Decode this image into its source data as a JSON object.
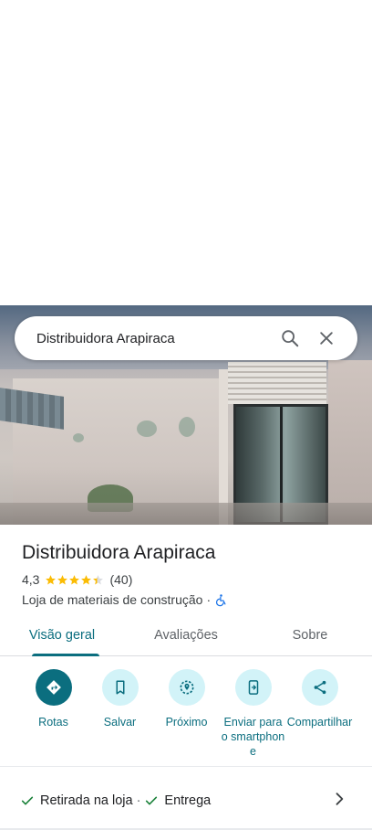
{
  "search": {
    "query": "Distribuidora Arapiraca",
    "search_icon": "search-icon",
    "close_icon": "close-icon"
  },
  "place": {
    "name": "Distribuidora Arapiraca",
    "rating": "4,3",
    "rating_value": 4.3,
    "reviews_count": "(40)",
    "category": "Loja de materiais de construção",
    "separator": "·",
    "accessibility_icon": "wheelchair-icon"
  },
  "tabs": [
    {
      "label": "Visão geral",
      "active": true
    },
    {
      "label": "Avaliações",
      "active": false
    },
    {
      "label": "Sobre",
      "active": false
    }
  ],
  "actions": [
    {
      "label": "Rotas",
      "icon": "directions-icon"
    },
    {
      "label": "Salvar",
      "icon": "bookmark-icon"
    },
    {
      "label": "Próximo",
      "icon": "nearby-icon"
    },
    {
      "label": "Enviar para o smartphone",
      "icon": "send-to-phone-icon"
    },
    {
      "label": "Compartilhar",
      "icon": "share-icon"
    }
  ],
  "services": {
    "item1": "Retirada na loja",
    "separator": "·",
    "item2": "Entrega",
    "check_icon": "check-icon",
    "chevron_icon": "chevron-right-icon"
  },
  "colors": {
    "accent": "#0b6e7f",
    "accent_light": "#d2f3f8",
    "star": "#fbbc04",
    "check": "#188038"
  }
}
